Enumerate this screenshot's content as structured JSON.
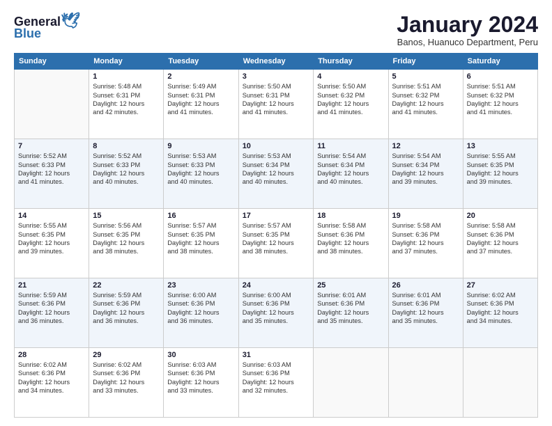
{
  "logo": {
    "line1": "General",
    "line2": "Blue"
  },
  "title": "January 2024",
  "subtitle": "Banos, Huanuco Department, Peru",
  "days_of_week": [
    "Sunday",
    "Monday",
    "Tuesday",
    "Wednesday",
    "Thursday",
    "Friday",
    "Saturday"
  ],
  "weeks": [
    [
      {
        "day": "",
        "info": ""
      },
      {
        "day": "1",
        "info": "Sunrise: 5:48 AM\nSunset: 6:31 PM\nDaylight: 12 hours\nand 42 minutes."
      },
      {
        "day": "2",
        "info": "Sunrise: 5:49 AM\nSunset: 6:31 PM\nDaylight: 12 hours\nand 41 minutes."
      },
      {
        "day": "3",
        "info": "Sunrise: 5:50 AM\nSunset: 6:31 PM\nDaylight: 12 hours\nand 41 minutes."
      },
      {
        "day": "4",
        "info": "Sunrise: 5:50 AM\nSunset: 6:32 PM\nDaylight: 12 hours\nand 41 minutes."
      },
      {
        "day": "5",
        "info": "Sunrise: 5:51 AM\nSunset: 6:32 PM\nDaylight: 12 hours\nand 41 minutes."
      },
      {
        "day": "6",
        "info": "Sunrise: 5:51 AM\nSunset: 6:32 PM\nDaylight: 12 hours\nand 41 minutes."
      }
    ],
    [
      {
        "day": "7",
        "info": "Sunrise: 5:52 AM\nSunset: 6:33 PM\nDaylight: 12 hours\nand 41 minutes."
      },
      {
        "day": "8",
        "info": "Sunrise: 5:52 AM\nSunset: 6:33 PM\nDaylight: 12 hours\nand 40 minutes."
      },
      {
        "day": "9",
        "info": "Sunrise: 5:53 AM\nSunset: 6:33 PM\nDaylight: 12 hours\nand 40 minutes."
      },
      {
        "day": "10",
        "info": "Sunrise: 5:53 AM\nSunset: 6:34 PM\nDaylight: 12 hours\nand 40 minutes."
      },
      {
        "day": "11",
        "info": "Sunrise: 5:54 AM\nSunset: 6:34 PM\nDaylight: 12 hours\nand 40 minutes."
      },
      {
        "day": "12",
        "info": "Sunrise: 5:54 AM\nSunset: 6:34 PM\nDaylight: 12 hours\nand 39 minutes."
      },
      {
        "day": "13",
        "info": "Sunrise: 5:55 AM\nSunset: 6:35 PM\nDaylight: 12 hours\nand 39 minutes."
      }
    ],
    [
      {
        "day": "14",
        "info": "Sunrise: 5:55 AM\nSunset: 6:35 PM\nDaylight: 12 hours\nand 39 minutes."
      },
      {
        "day": "15",
        "info": "Sunrise: 5:56 AM\nSunset: 6:35 PM\nDaylight: 12 hours\nand 38 minutes."
      },
      {
        "day": "16",
        "info": "Sunrise: 5:57 AM\nSunset: 6:35 PM\nDaylight: 12 hours\nand 38 minutes."
      },
      {
        "day": "17",
        "info": "Sunrise: 5:57 AM\nSunset: 6:35 PM\nDaylight: 12 hours\nand 38 minutes."
      },
      {
        "day": "18",
        "info": "Sunrise: 5:58 AM\nSunset: 6:36 PM\nDaylight: 12 hours\nand 38 minutes."
      },
      {
        "day": "19",
        "info": "Sunrise: 5:58 AM\nSunset: 6:36 PM\nDaylight: 12 hours\nand 37 minutes."
      },
      {
        "day": "20",
        "info": "Sunrise: 5:58 AM\nSunset: 6:36 PM\nDaylight: 12 hours\nand 37 minutes."
      }
    ],
    [
      {
        "day": "21",
        "info": "Sunrise: 5:59 AM\nSunset: 6:36 PM\nDaylight: 12 hours\nand 36 minutes."
      },
      {
        "day": "22",
        "info": "Sunrise: 5:59 AM\nSunset: 6:36 PM\nDaylight: 12 hours\nand 36 minutes."
      },
      {
        "day": "23",
        "info": "Sunrise: 6:00 AM\nSunset: 6:36 PM\nDaylight: 12 hours\nand 36 minutes."
      },
      {
        "day": "24",
        "info": "Sunrise: 6:00 AM\nSunset: 6:36 PM\nDaylight: 12 hours\nand 35 minutes."
      },
      {
        "day": "25",
        "info": "Sunrise: 6:01 AM\nSunset: 6:36 PM\nDaylight: 12 hours\nand 35 minutes."
      },
      {
        "day": "26",
        "info": "Sunrise: 6:01 AM\nSunset: 6:36 PM\nDaylight: 12 hours\nand 35 minutes."
      },
      {
        "day": "27",
        "info": "Sunrise: 6:02 AM\nSunset: 6:36 PM\nDaylight: 12 hours\nand 34 minutes."
      }
    ],
    [
      {
        "day": "28",
        "info": "Sunrise: 6:02 AM\nSunset: 6:36 PM\nDaylight: 12 hours\nand 34 minutes."
      },
      {
        "day": "29",
        "info": "Sunrise: 6:02 AM\nSunset: 6:36 PM\nDaylight: 12 hours\nand 33 minutes."
      },
      {
        "day": "30",
        "info": "Sunrise: 6:03 AM\nSunset: 6:36 PM\nDaylight: 12 hours\nand 33 minutes."
      },
      {
        "day": "31",
        "info": "Sunrise: 6:03 AM\nSunset: 6:36 PM\nDaylight: 12 hours\nand 32 minutes."
      },
      {
        "day": "",
        "info": ""
      },
      {
        "day": "",
        "info": ""
      },
      {
        "day": "",
        "info": ""
      }
    ]
  ]
}
